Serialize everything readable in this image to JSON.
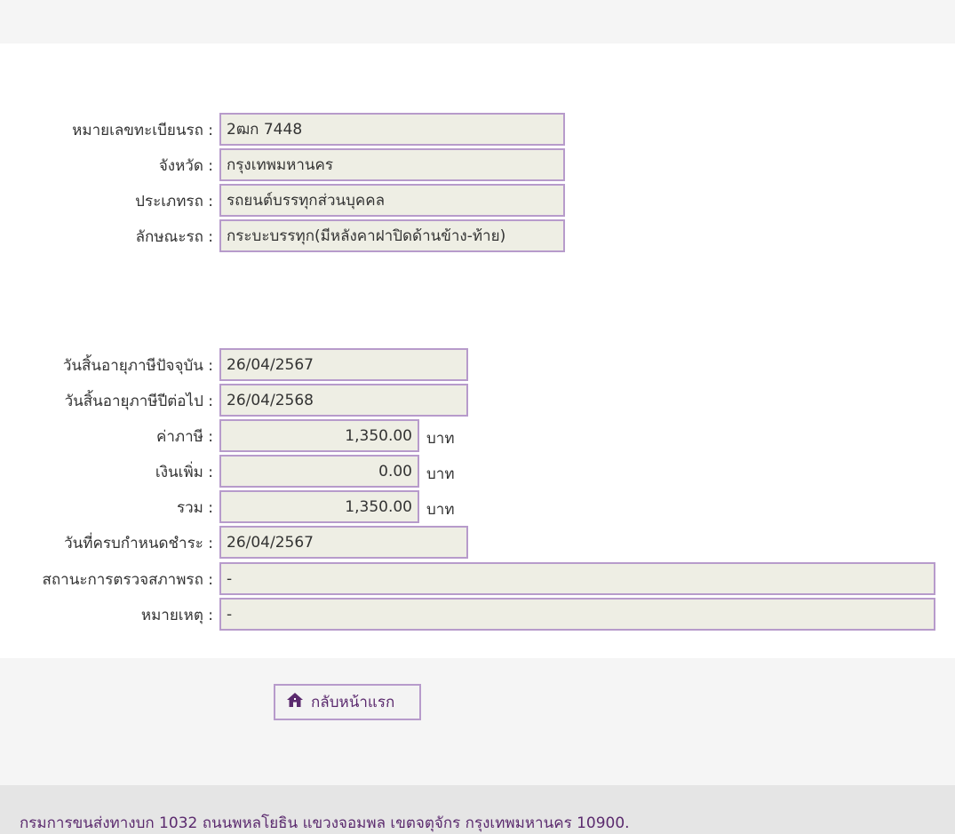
{
  "vehicle": {
    "plate_label": "หมายเลขทะเบียนรถ :",
    "plate_value": "2ฒก 7448",
    "province_label": "จังหวัด :",
    "province_value": "กรุงเทพมหานคร",
    "type_label": "ประเภทรถ :",
    "type_value": "รถยนต์บรรทุกส่วนบุคคล",
    "body_label": "ลักษณะรถ :",
    "body_value": "กระบะบรรทุก(มีหลังคาฝาปิดด้านข้าง-ท้าย)"
  },
  "tax": {
    "current_expiry_label": "วันสิ้นอายุภาษีปัจจุบัน :",
    "current_expiry_value": "26/04/2567",
    "next_expiry_label": "วันสิ้นอายุภาษีปีต่อไป :",
    "next_expiry_value": "26/04/2568",
    "tax_label": "ค่าภาษี :",
    "tax_value": "1,350.00",
    "surcharge_label": "เงินเพิ่ม :",
    "surcharge_value": "0.00",
    "total_label": "รวม :",
    "total_value": "1,350.00",
    "currency_unit": "บาท",
    "due_date_label": "วันที่ครบกำหนดชำระ :",
    "due_date_value": "26/04/2567",
    "inspection_label": "สถานะการตรวจสภาพรถ :",
    "inspection_value": "-",
    "remark_label": "หมายเหตุ :",
    "remark_value": "-"
  },
  "actions": {
    "home_label": "กลับหน้าแรก",
    "home_icon": "home-icon"
  },
  "footer": {
    "address": "กรมการขนส่งทางบก 1032 ถนนพหลโยธิน แขวงจอมพล เขตจตุจักร กรุงเทพมหานคร 10900."
  },
  "colors": {
    "field_bg": "#eeeee4",
    "field_border": "#b79bcb",
    "accent": "#5b2a6e",
    "band_bg": "#f5f5f5",
    "footer_bg": "#e5e5e5"
  }
}
